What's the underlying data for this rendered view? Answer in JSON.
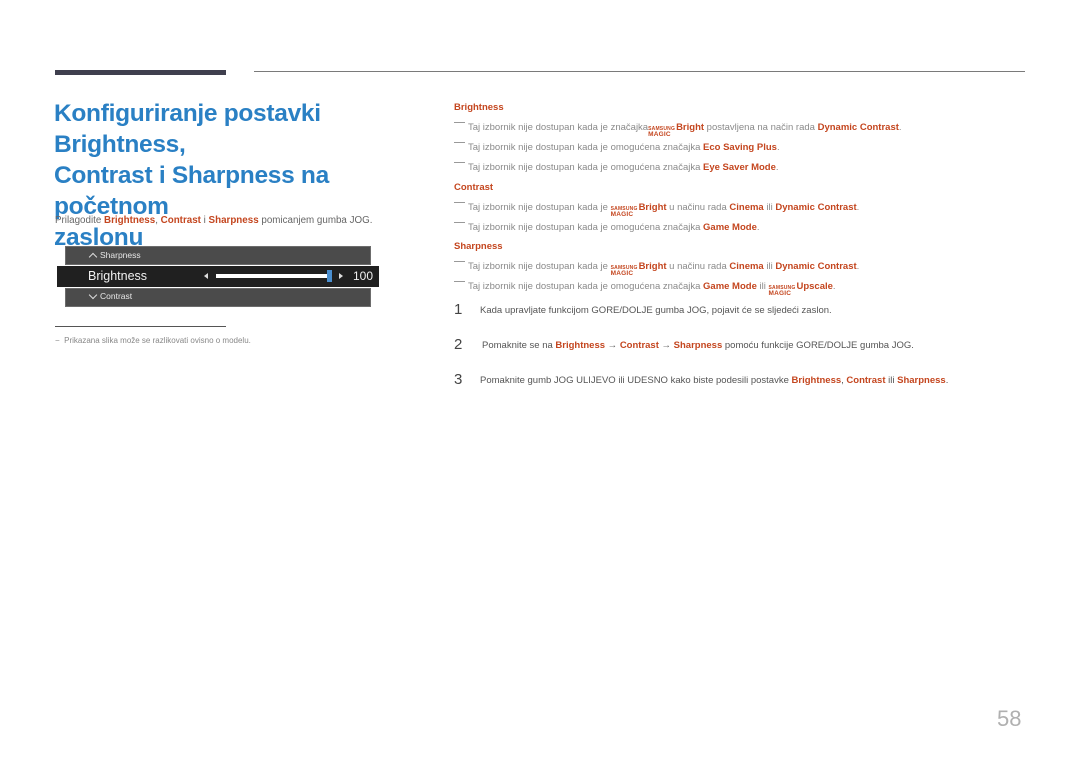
{
  "page": {
    "title": "Konfiguriranje postavki Brightness, Contrast i Sharpness na početnom zaslonu",
    "title_lines": [
      "Konfiguriranje postavki Brightness,",
      "Contrast i Sharpness na početnom",
      "zaslonu"
    ],
    "page_number": "58"
  },
  "intro": {
    "prefix": "Prilagodite ",
    "term1": "Brightness",
    "sep1": ", ",
    "term2": "Contrast",
    "sep2": " i ",
    "term3": "Sharpness",
    "suffix": " pomicanjem gumba JOG."
  },
  "osd": {
    "prev_item": "Sharpness",
    "current_item": "Brightness",
    "next_item": "Contrast",
    "value": "100",
    "value_fraction": 1.0,
    "accent_color": "#4a8fd0"
  },
  "footnote": {
    "dash": "−",
    "text": "Prikazana slika može se razlikovati ovisno o modelu."
  },
  "magic_logo": {
    "top": "SAMSUNG",
    "bottom": "MAGIC"
  },
  "sections": {
    "brightness": {
      "heading": "Brightness",
      "notes": [
        {
          "pre": "Taj izbornik nije dostupan kada je značajka ",
          "magic": "Bright",
          "mid": " postavljena na način rada ",
          "hl1": "Dynamic Contrast",
          "end": "."
        },
        {
          "pre": "Taj izbornik nije dostupan kada je omogućena značajka ",
          "hl1": "Eco Saving Plus",
          "end": "."
        },
        {
          "pre": "Taj izbornik nije dostupan kada je omogućena značajka ",
          "hl1": "Eye Saver Mode",
          "end": "."
        }
      ]
    },
    "contrast": {
      "heading": "Contrast",
      "notes": [
        {
          "pre": "Taj izbornik nije dostupan kada je ",
          "magic": "Bright",
          "mid": " u načinu rada ",
          "hl1": "Cinema",
          "mid2": " ili ",
          "hl2": "Dynamic Contrast",
          "end": "."
        },
        {
          "pre": "Taj izbornik nije dostupan kada je omogućena značajka ",
          "hl1": "Game Mode",
          "end": "."
        }
      ]
    },
    "sharpness": {
      "heading": "Sharpness",
      "notes": [
        {
          "pre": "Taj izbornik nije dostupan kada je ",
          "magic": "Bright",
          "mid": " u načinu rada ",
          "hl1": "Cinema",
          "mid2": " ili ",
          "hl2": "Dynamic Contrast",
          "end": "."
        },
        {
          "pre": "Taj izbornik nije dostupan kada je omogućena značajka ",
          "hl1": "Game Mode",
          "mid2": " ili ",
          "magic": "Upscale",
          "end": "."
        }
      ]
    }
  },
  "steps": [
    {
      "num": "1",
      "text": "Kada upravljate funkcijom GORE/DOLJE gumba JOG, pojavit će se sljedeći zaslon."
    },
    {
      "num": "2",
      "pre": "Pomaknite se na ",
      "t1": "Brightness",
      "a1": " → ",
      "t2": "Contrast",
      "a2": " → ",
      "t3": "Sharpness",
      "end": " pomoću funkcije GORE/DOLJE gumba JOG."
    },
    {
      "num": "3",
      "pre": "Pomaknite gumb JOG ULIJEVO ili UDESNO kako biste podesili postavke ",
      "t1": "Brightness",
      "a1": ", ",
      "t2": "Contrast",
      "a2": " ili ",
      "t3": "Sharpness",
      "end": "."
    }
  ],
  "colors": {
    "title": "#2a80c4",
    "highlight": "#c4461f",
    "body_text": "#555555"
  }
}
